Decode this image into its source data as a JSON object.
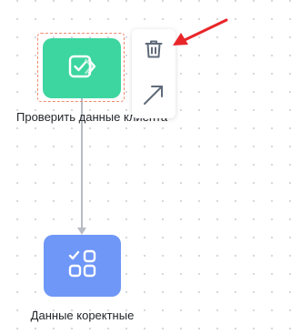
{
  "nodes": [
    {
      "label": "Проверить данные клиента",
      "color": "#3dd6a0",
      "icon": "checklist-icon",
      "selected": true
    },
    {
      "label": "Данные коректные",
      "color": "#6f97f7",
      "icon": "grid-check-icon",
      "selected": false
    }
  ],
  "actions": [
    {
      "icon": "trash-icon"
    },
    {
      "icon": "arrow-up-right-icon"
    }
  ],
  "colors": {
    "connector": "#b8bcc4",
    "selection": "#f08a6e",
    "annotation_arrow": "#e8262a",
    "action_icon": "#5f6b7a"
  }
}
